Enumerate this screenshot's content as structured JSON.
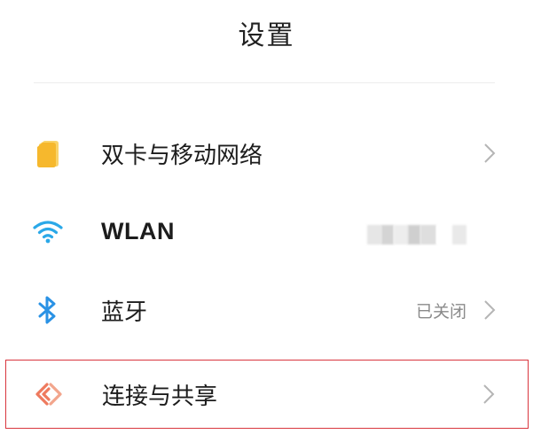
{
  "header": {
    "title": "设置"
  },
  "settings_items": [
    {
      "label": "双卡与移动网络",
      "value": "",
      "icon": "sim-card-icon",
      "icon_color": "#f6b82d"
    },
    {
      "label": "WLAN",
      "value": "",
      "icon": "wifi-icon",
      "icon_color": "#2aa8e8",
      "value_obscured": true
    },
    {
      "label": "蓝牙",
      "value": "已关闭",
      "icon": "bluetooth-icon",
      "icon_color": "#2a92e5"
    },
    {
      "label": "连接与共享",
      "value": "",
      "icon": "connection-sharing-icon",
      "icon_color": "#ee7a5e",
      "highlighted": true
    }
  ],
  "colors": {
    "highlight_border": "#d9363e",
    "chevron": "#b5b5b5",
    "secondary_text": "#8a8a8a"
  }
}
